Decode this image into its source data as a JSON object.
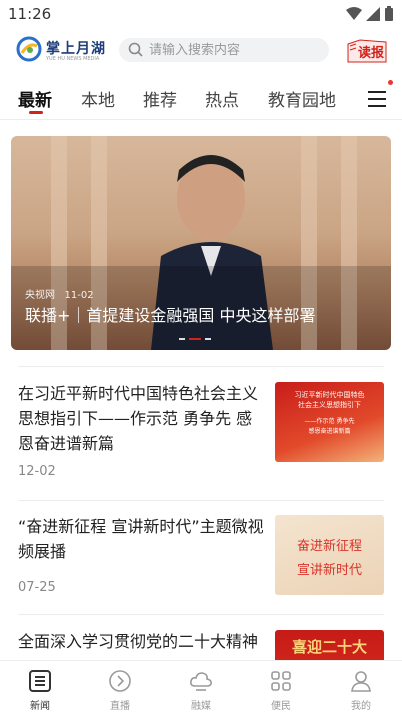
{
  "status_bar": {
    "time": "11:26"
  },
  "header": {
    "logo_text": "掌上月湖",
    "logo_subtext": "YUE HU NEWS MEDIA",
    "search_placeholder": "请输入搜索内容",
    "read_button_label": "读报"
  },
  "tabs": [
    {
      "label": "最新",
      "active": true
    },
    {
      "label": "本地",
      "active": false
    },
    {
      "label": "推荐",
      "active": false
    },
    {
      "label": "热点",
      "active": false
    },
    {
      "label": "教育园地",
      "active": false
    }
  ],
  "hero": {
    "source": "央视网",
    "date": "11-02",
    "title": "联播+｜首提建设金融强国 中央这样部署",
    "slide_count": 3,
    "active_slide": 2
  },
  "news": [
    {
      "title": "在习近平新时代中国特色社会主义思想指引下——作示范 勇争先 感恩奋进谱新篇",
      "date": "12-02",
      "thumb_lines": [
        "习近平新时代中国特色",
        "社会主义思想指引下",
        "——作示范 勇争先",
        "感恩奋进谱新篇"
      ]
    },
    {
      "title": "“奋进新征程 宣讲新时代”主题微视频展播",
      "date": "07-25",
      "thumb_lines": [
        "奋进新征程",
        "宣讲新时代"
      ]
    },
    {
      "title": "全面深入学习贯彻党的二十大精神",
      "date": "",
      "thumb_lines": [
        "喜迎二十大"
      ]
    }
  ],
  "bottom_nav": [
    {
      "label": "新闻",
      "icon": "news-icon",
      "active": true
    },
    {
      "label": "直播",
      "icon": "play-icon",
      "active": false
    },
    {
      "label": "融媒",
      "icon": "cloud-icon",
      "active": false
    },
    {
      "label": "便民",
      "icon": "grid-icon",
      "active": false
    },
    {
      "label": "我的",
      "icon": "user-icon",
      "active": false
    }
  ],
  "colors": {
    "accent": "#d0231b",
    "text": "#222222",
    "muted": "#888888"
  }
}
